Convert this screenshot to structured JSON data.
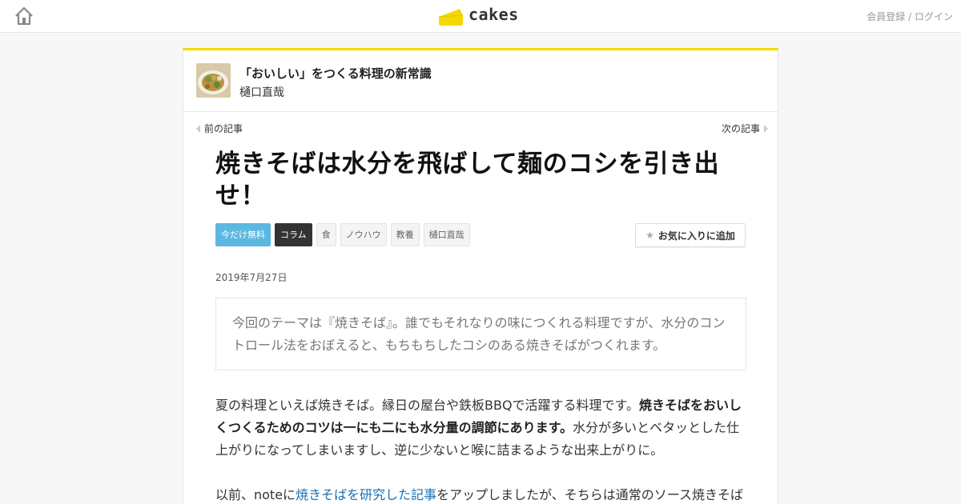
{
  "header": {
    "logo_text": "cakes",
    "auth_register": "会員登録",
    "auth_separator": " / ",
    "auth_login": "ログイン",
    "accent_color": "#f5d800"
  },
  "series": {
    "title": "「おいしい」をつくる料理の新常識",
    "author": "樋口直哉"
  },
  "nav": {
    "prev": "前の記事",
    "next": "次の記事"
  },
  "article": {
    "title": "焼きそばは水分を飛ばして麺のコシを引き出せ！",
    "tags": [
      "今だけ無料",
      "コラム",
      "食",
      "ノウハウ",
      "教養",
      "樋口直哉"
    ],
    "favorite_label": "お気に入りに追加",
    "date": "2019年7月27日",
    "lead": "今回のテーマは『焼きそば』。誰でもそれなりの味につくれる料理ですが、水分のコントロール法をおぼえると、もちもちしたコシのある焼きそばがつくれます。",
    "p1_before": "夏の料理といえば焼きそば。縁日の屋台や鉄板BBQで活躍する料理です。",
    "p1_bold": "焼きそばをおいしくつくるためのコツは一にも二にも水分量の調節にあります。",
    "p1_after": "水分が多いとベタッとした仕上がりになってしまいますし、逆に少ないと喉に詰まるような出来上がりに。",
    "p2_before": "以前、noteに",
    "p2_link": "焼きそばを研究した記事",
    "p2_after": "をアップしましたが、そちらは通常のソース焼きそば"
  }
}
